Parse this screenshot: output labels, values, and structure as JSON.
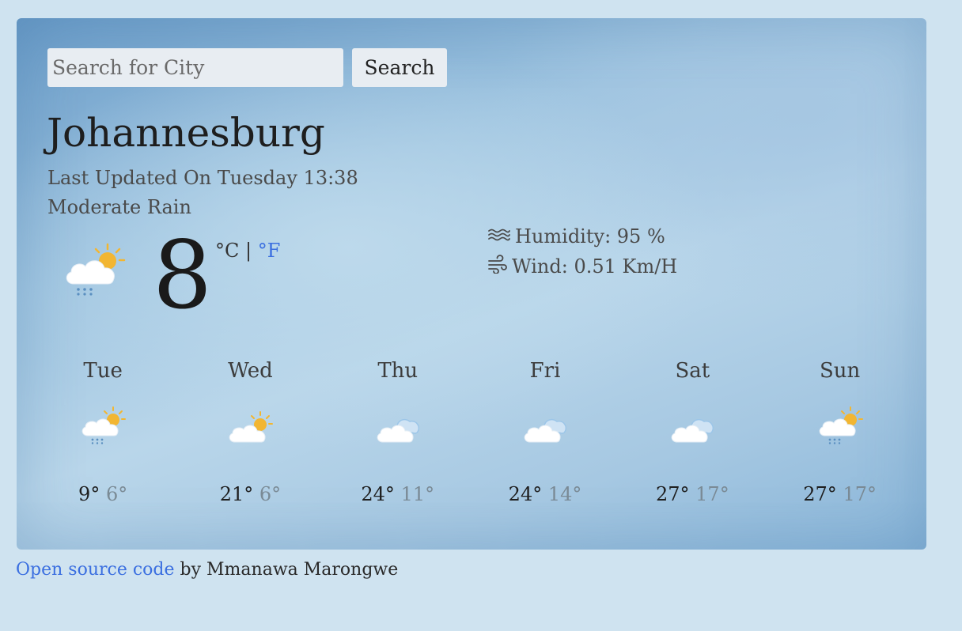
{
  "search": {
    "placeholder": "Search for City",
    "value": "",
    "button_label": "Search"
  },
  "current": {
    "city": "Johannesburg",
    "last_updated": "Last Updated On Tuesday 13:38",
    "condition": "Moderate Rain",
    "icon": "sun-cloud-rain-icon",
    "temperature": "8",
    "unit_celsius": "°C",
    "unit_separator": "|",
    "unit_fahrenheit": "°F",
    "humidity": "Humidity: 95 %",
    "wind": "Wind: 0.51 Km/H"
  },
  "forecast": [
    {
      "day": "Tue",
      "icon": "sun-cloud-rain-icon",
      "max": "9°",
      "min": "6°"
    },
    {
      "day": "Wed",
      "icon": "sun-cloud-icon",
      "max": "21°",
      "min": "6°"
    },
    {
      "day": "Thu",
      "icon": "cloud-icon",
      "max": "24°",
      "min": "11°"
    },
    {
      "day": "Fri",
      "icon": "cloud-icon",
      "max": "24°",
      "min": "14°"
    },
    {
      "day": "Sat",
      "icon": "cloud-icon",
      "max": "27°",
      "min": "17°"
    },
    {
      "day": "Sun",
      "icon": "sun-cloud-rain-icon",
      "max": "27°",
      "min": "17°"
    }
  ],
  "footer": {
    "link_text": "Open source code",
    "suffix": " by Mmanawa Marongwe"
  },
  "colors": {
    "page_background": "#cfe3f0",
    "link": "#3b6fe0",
    "sun": "#f2b632",
    "rain": "#5a8fc0"
  }
}
